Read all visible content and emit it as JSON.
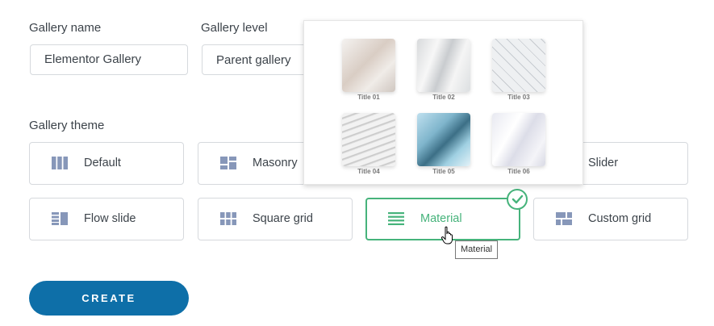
{
  "form": {
    "gallery_name_label": "Gallery name",
    "gallery_name_value": "Elementor Gallery",
    "gallery_level_label": "Gallery level",
    "gallery_level_value": "Parent gallery",
    "gallery_theme_label": "Gallery theme"
  },
  "themes": [
    {
      "label": "Default",
      "icon": "columns-icon"
    },
    {
      "label": "Masonry",
      "icon": "masonry-icon"
    },
    {
      "label": "Slider",
      "icon": "slider-icon"
    },
    {
      "label": "Flow slide",
      "icon": "flow-slide-icon"
    },
    {
      "label": "Square grid",
      "icon": "square-grid-icon"
    },
    {
      "label": "Material",
      "icon": "material-icon",
      "selected": true
    },
    {
      "label": "Custom grid",
      "icon": "custom-grid-icon"
    }
  ],
  "preview": {
    "items": [
      "Title 01",
      "Title 02",
      "Title 03",
      "Title 04",
      "Title 05",
      "Title 06"
    ]
  },
  "tooltip": "Material",
  "create_label": "CREATE",
  "colors": {
    "accent_green": "#46b37b",
    "button_blue": "#0e6fa8",
    "icon_blue": "#8797b9"
  }
}
